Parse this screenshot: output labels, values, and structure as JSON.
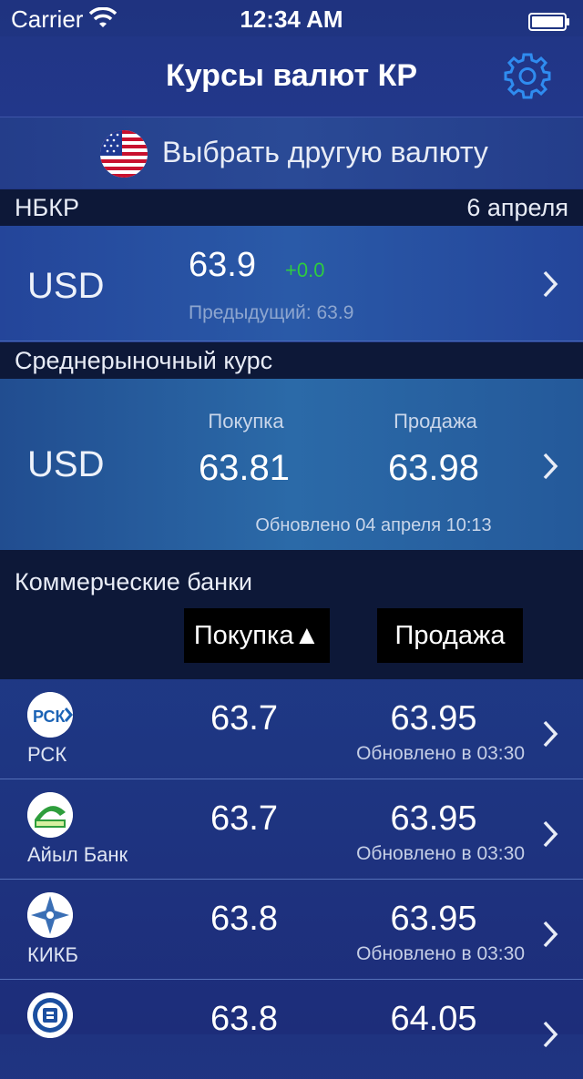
{
  "status": {
    "carrier": "Carrier",
    "time": "12:34 AM"
  },
  "nav": {
    "title": "Курсы валют КР"
  },
  "choose": {
    "label": "Выбрать другую валюту"
  },
  "nbkr": {
    "header": "НБКР",
    "date": "6 апреля",
    "currency": "USD",
    "rate": "63.9",
    "change": "+0.0",
    "change_color": "#2ecc40",
    "previous": "Предыдущий: 63.9"
  },
  "market": {
    "header": "Среднерыночный курс",
    "currency": "USD",
    "buy_label": "Покупка",
    "sell_label": "Продажа",
    "buy": "63.81",
    "sell": "63.98",
    "updated": "Обновлено 04 апреля 10:13"
  },
  "commercial": {
    "header": "Коммерческие банки",
    "sort_buy": "Покупка",
    "sort_buy_indicator": "▲",
    "sort_sell": "Продажа"
  },
  "banks": [
    {
      "name": "РСК",
      "logo": "rsk-logo",
      "buy": "63.7",
      "sell": "63.95",
      "updated": "Обновлено в 03:30"
    },
    {
      "name": "Айыл Банк",
      "logo": "aiyl-bank-logo",
      "buy": "63.7",
      "sell": "63.95",
      "updated": "Обновлено в 03:30"
    },
    {
      "name": "КИКБ",
      "logo": "kicb-logo",
      "buy": "63.8",
      "sell": "63.95",
      "updated": "Обновлено в 03:30"
    },
    {
      "name": "",
      "logo": "bank-logo",
      "buy": "63.8",
      "sell": "64.05",
      "updated": ""
    }
  ],
  "colors": {
    "accent": "#2f8cf0",
    "positive": "#2ecc40"
  }
}
